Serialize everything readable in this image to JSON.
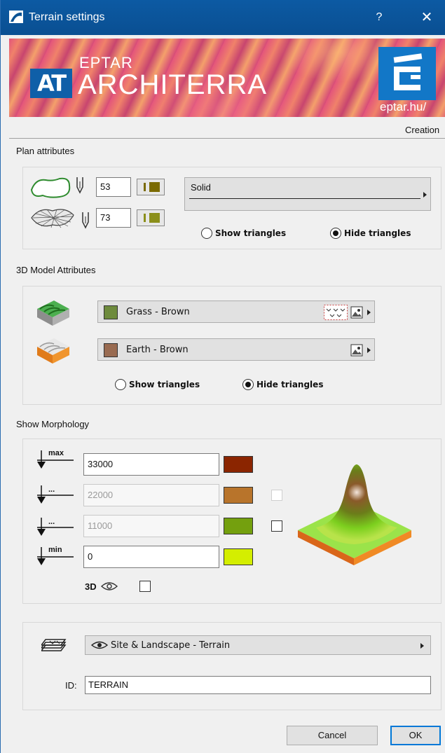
{
  "window": {
    "title": "Terrain settings",
    "help_glyph": "?",
    "close_glyph": "✕"
  },
  "banner": {
    "logo_text": "AT",
    "brand_small": "EPTAR",
    "brand_big": "ARCHITERRA",
    "link_text": "eptar.hu/"
  },
  "tab": {
    "label": "Creation"
  },
  "plan": {
    "label": "Plan attributes",
    "contour_pen": "53",
    "mesh_pen": "73",
    "contour_pen_color": "#7a6a00",
    "mesh_pen_color": "#8b8f1a",
    "line_type": "Solid",
    "show_triangles": "Show triangles",
    "hide_triangles": "Hide triangles",
    "selected": "hide"
  },
  "model3d": {
    "label": "3D Model Attributes",
    "top_material": {
      "name": "Grass - Brown",
      "color": "#6e8b3d"
    },
    "side_material": {
      "name": "Earth - Brown",
      "color": "#996b51"
    },
    "show_triangles": "Show triangles",
    "hide_triangles": "Hide triangles",
    "selected": "hide"
  },
  "morphology": {
    "label": "Show Morphology",
    "max_tag": "max",
    "min_tag": "min",
    "mid_tag": "...",
    "levels": [
      {
        "value": "33000",
        "color": "#8b2500",
        "enabled": true
      },
      {
        "value": "22000",
        "color": "#b8742b",
        "enabled": false
      },
      {
        "value": "11000",
        "color": "#74a00e",
        "enabled": false
      },
      {
        "value": "0",
        "color": "#d4ee00",
        "enabled": true
      }
    ],
    "view3d_label": "3D",
    "view3d_checked": false
  },
  "layer": {
    "name": "Site & Landscape - Terrain",
    "id_label": "ID:",
    "id_value": "TERRAIN"
  },
  "buttons": {
    "cancel": "Cancel",
    "ok": "OK"
  }
}
